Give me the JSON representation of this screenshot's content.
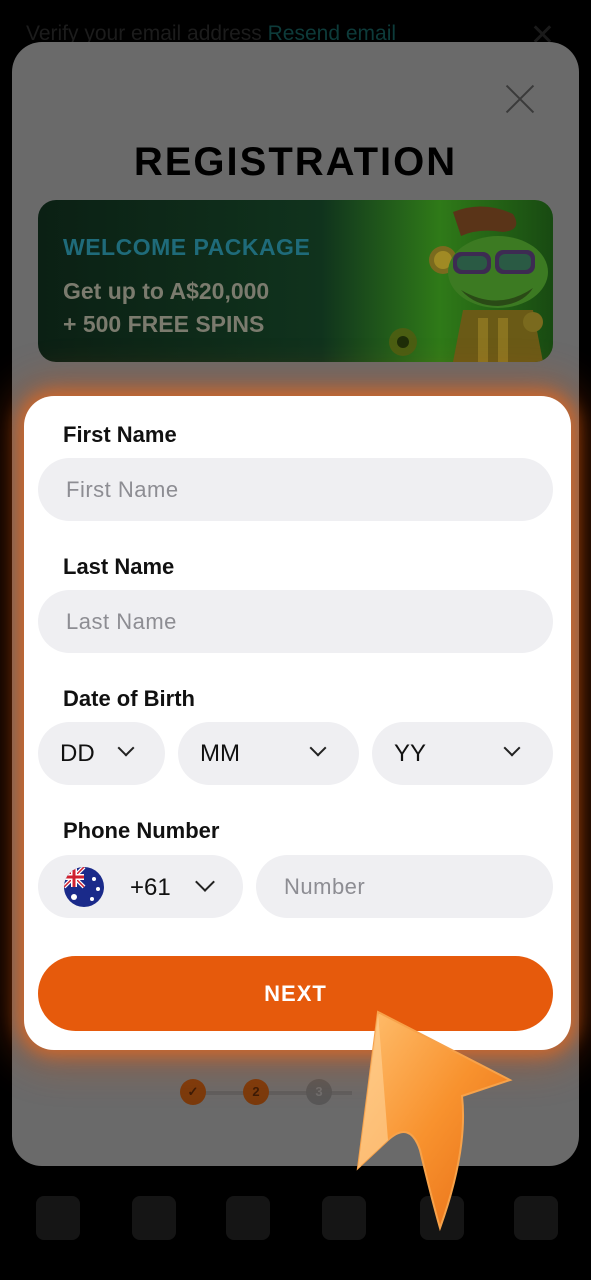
{
  "verify_bar": {
    "text": "Verify your email address",
    "link": "Resend email"
  },
  "modal": {
    "title": "REGISTRATION"
  },
  "banner": {
    "title": "WELCOME PACKAGE",
    "line1": "Get up to A$20,000",
    "line2": "+ 500 FREE SPINS"
  },
  "form": {
    "first_name_label": "First Name",
    "first_name_placeholder": "First Name",
    "last_name_label": "Last Name",
    "last_name_placeholder": "Last Name",
    "dob_label": "Date of Birth",
    "dob_day": "DD",
    "dob_month": "MM",
    "dob_year": "YY",
    "phone_label": "Phone Number",
    "phone_code": "+61",
    "phone_placeholder": "Number",
    "next_label": "NEXT"
  },
  "steps": [
    "✓",
    "2",
    "3"
  ],
  "colors": {
    "accent": "#e65a0c",
    "input_bg": "#efeff2",
    "banner_title": "#1f6b7a"
  },
  "icons": [
    "close-icon",
    "chevron-down-icon",
    "australia-flag-icon",
    "pointer-arrow-icon",
    "check-icon"
  ]
}
